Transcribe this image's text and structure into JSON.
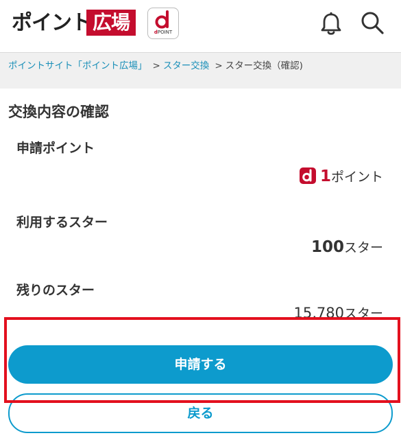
{
  "header": {
    "logo_text": "ポイント",
    "logo_box_text": "広場",
    "dpoint_badge_mark": "d",
    "dpoint_badge_caption": "POINT",
    "icons": [
      "bell-icon",
      "search-icon"
    ]
  },
  "breadcrumb": {
    "items": [
      "ポイントサイト「ポイント広場」",
      "スター交換",
      "スター交換（確認)"
    ],
    "separator": ">"
  },
  "main": {
    "title": "交換内容の確認",
    "rows": [
      {
        "label": "申請ポイント",
        "value": "1",
        "unit": "ポイント"
      },
      {
        "label": "利用するスター",
        "value": "100",
        "unit": "スター"
      },
      {
        "label": "残りのスター",
        "value": "15,780",
        "unit": "スター"
      }
    ]
  },
  "buttons": {
    "apply": "申請する",
    "back": "戻る"
  },
  "colors": {
    "brand_red": "#c40d2e",
    "primary_blue": "#0d9bcd",
    "link_blue": "#1a8fb8",
    "highlight_red": "#e3101e",
    "breadcrumb_bg": "#f0f0f0"
  }
}
